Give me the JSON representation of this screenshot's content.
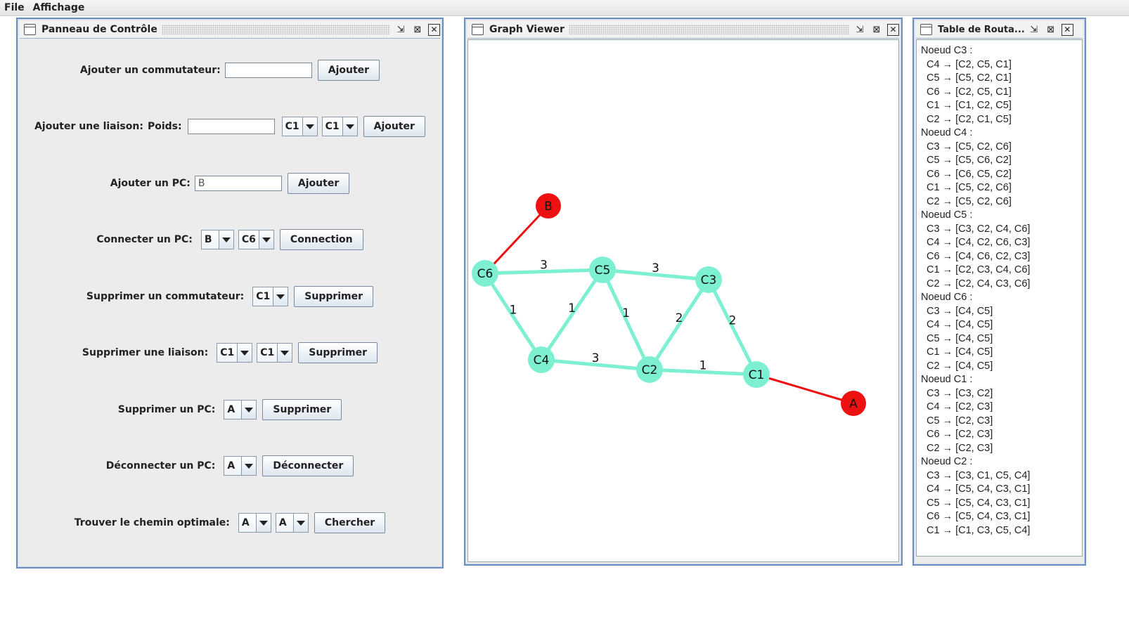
{
  "menu": {
    "items": [
      "File",
      "Affichage"
    ]
  },
  "control_panel": {
    "title": "Panneau de Contrôle",
    "add_switch": {
      "label": "Ajouter un commutateur:",
      "value": "",
      "button": "Ajouter"
    },
    "add_link": {
      "label": "Ajouter une liaison:",
      "weight_label": "Poids:",
      "weight_value": "",
      "from": "C1",
      "to": "C1",
      "button": "Ajouter"
    },
    "add_pc": {
      "label": "Ajouter un PC:",
      "value": "B",
      "button": "Ajouter"
    },
    "connect_pc": {
      "label": "Connecter un PC:",
      "pc": "B",
      "switch": "C6",
      "button": "Connection"
    },
    "delete_switch": {
      "label": "Supprimer un commutateur:",
      "switch": "C1",
      "button": "Supprimer"
    },
    "delete_link": {
      "label": "Supprimer une liaison:",
      "from": "C1",
      "to": "C1",
      "button": "Supprimer"
    },
    "delete_pc": {
      "label": "Supprimer un PC:",
      "pc": "A",
      "button": "Supprimer"
    },
    "disconnect_pc": {
      "label": "Déconnecter un PC:",
      "pc": "A",
      "button": "Déconnecter"
    },
    "find_path": {
      "label": "Trouver le chemin optimale:",
      "from": "A",
      "to": "A",
      "button": "Chercher"
    }
  },
  "graph_viewer": {
    "title": "Graph Viewer",
    "colors": {
      "switch": "#7ef0d2",
      "pc": "#ee1111",
      "switch_edge": "#7ef0d2",
      "pc_edge": "#ee1111"
    },
    "nodes": [
      {
        "id": "B",
        "type": "pc"
      },
      {
        "id": "C6",
        "type": "switch"
      },
      {
        "id": "C5",
        "type": "switch"
      },
      {
        "id": "C3",
        "type": "switch"
      },
      {
        "id": "C4",
        "type": "switch"
      },
      {
        "id": "C2",
        "type": "switch"
      },
      {
        "id": "C1",
        "type": "switch"
      },
      {
        "id": "A",
        "type": "pc"
      }
    ],
    "edges": [
      {
        "from": "C6",
        "to": "B",
        "weight": ""
      },
      {
        "from": "C6",
        "to": "C5",
        "weight": "3"
      },
      {
        "from": "C5",
        "to": "C3",
        "weight": "3"
      },
      {
        "from": "C6",
        "to": "C4",
        "weight": "1"
      },
      {
        "from": "C5",
        "to": "C4",
        "weight": "1"
      },
      {
        "from": "C5",
        "to": "C2",
        "weight": "1"
      },
      {
        "from": "C3",
        "to": "C2",
        "weight": "2"
      },
      {
        "from": "C3",
        "to": "C1",
        "weight": "2"
      },
      {
        "from": "C4",
        "to": "C2",
        "weight": "3"
      },
      {
        "from": "C2",
        "to": "C1",
        "weight": "1"
      },
      {
        "from": "C1",
        "to": "A",
        "weight": ""
      }
    ]
  },
  "routing_table": {
    "title": "Table de Routa...",
    "nodes": [
      {
        "header": "Noeud C3 :",
        "entries": [
          "C4 → [C2, C5, C1]",
          "C5 → [C5, C2, C1]",
          "C6 → [C2, C5, C1]",
          "C1 → [C1, C2, C5]",
          "C2 → [C2, C1, C5]"
        ]
      },
      {
        "header": "Noeud C4 :",
        "entries": [
          "C3 → [C5, C2, C6]",
          "C5 → [C5, C6, C2]",
          "C6 → [C6, C5, C2]",
          "C1 → [C5, C2, C6]",
          "C2 → [C5, C2, C6]"
        ]
      },
      {
        "header": "Noeud C5 :",
        "entries": [
          "C3 → [C3, C2, C4, C6]",
          "C4 → [C4, C2, C6, C3]",
          "C6 → [C4, C6, C2, C3]",
          "C1 → [C2, C3, C4, C6]",
          "C2 → [C2, C4, C3, C6]"
        ]
      },
      {
        "header": "Noeud C6 :",
        "entries": [
          "C3 → [C4, C5]",
          "C4 → [C4, C5]",
          "C5 → [C4, C5]",
          "C1 → [C4, C5]",
          "C2 → [C4, C5]"
        ]
      },
      {
        "header": "Noeud C1 :",
        "entries": [
          "C3 → [C3, C2]",
          "C4 → [C2, C3]",
          "C5 → [C2, C3]",
          "C6 → [C2, C3]",
          "C2 → [C2, C3]"
        ]
      },
      {
        "header": "Noeud C2 :",
        "entries": [
          "C3 → [C3, C1, C5, C4]",
          "C4 → [C5, C4, C3, C1]",
          "C5 → [C5, C4, C3, C1]",
          "C6 → [C5, C4, C3, C1]",
          "C1 → [C1, C3, C5, C4]"
        ]
      }
    ]
  }
}
